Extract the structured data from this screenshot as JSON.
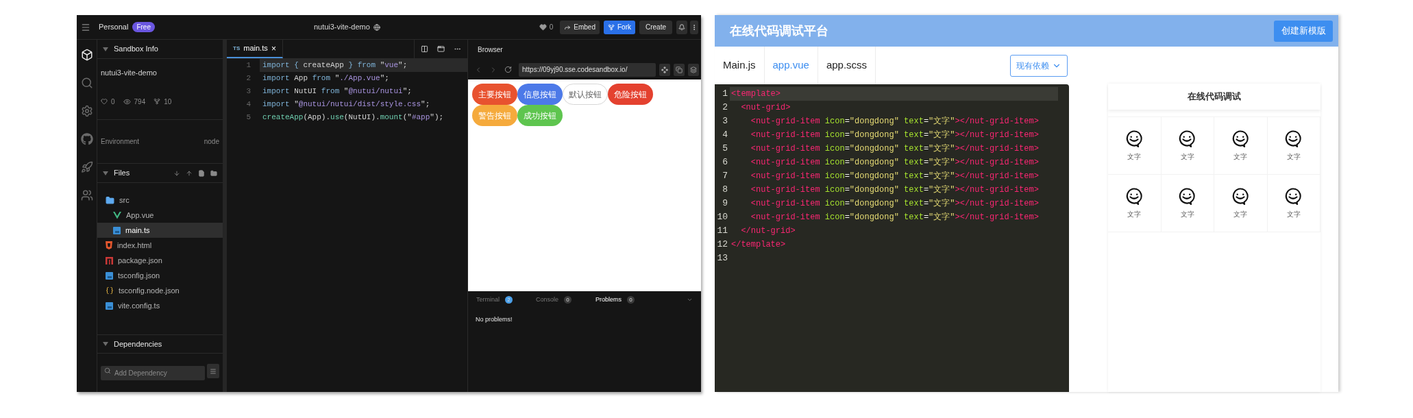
{
  "left": {
    "topbar": {
      "workspace": "Personal",
      "plan": "Free",
      "title": "nutui3-vite-demo",
      "likes": "0",
      "embed": "Embed",
      "fork": "Fork",
      "create": "Create"
    },
    "activity_bar": [
      {
        "kind": "cube",
        "selected": true
      },
      {
        "kind": "search",
        "selected": false
      },
      {
        "kind": "gear",
        "selected": false
      },
      {
        "kind": "github",
        "selected": false
      },
      {
        "kind": "rocket",
        "selected": false
      },
      {
        "kind": "users",
        "selected": false
      }
    ],
    "sandbox_info": {
      "title": "Sandbox Info",
      "name": "nutui3-vite-demo",
      "likes": "0",
      "views": "794",
      "forks": "10",
      "environment_label": "Environment",
      "environment": "node"
    },
    "files": {
      "title": "Files",
      "tree": [
        {
          "name": "src",
          "kind": "folder",
          "selected": false,
          "children": [
            {
              "name": "App.vue",
              "kind": "vue",
              "selected": false
            },
            {
              "name": "main.ts",
              "kind": "ts",
              "selected": true
            }
          ]
        },
        {
          "name": "index.html",
          "kind": "html",
          "selected": false
        },
        {
          "name": "package.json",
          "kind": "npm",
          "selected": false
        },
        {
          "name": "tsconfig.json",
          "kind": "ts",
          "selected": false
        },
        {
          "name": "tsconfig.node.json",
          "kind": "json",
          "selected": false
        },
        {
          "name": "vite.config.ts",
          "kind": "ts",
          "selected": false
        }
      ]
    },
    "dependencies": {
      "title": "Dependencies",
      "search": {
        "placeholder": "Add Dependency"
      }
    },
    "editor": {
      "tab": {
        "badge": "TS",
        "label": "main.ts",
        "close": "×"
      },
      "lines": [
        {
          "number": "1",
          "active": true,
          "tokens": [
            {
              "text": "import",
              "kind": "kw"
            },
            {
              "text": " { ",
              "kind": "kw"
            },
            {
              "text": "createApp",
              "kind": "plain"
            },
            {
              "text": " } ",
              "kind": "kw"
            },
            {
              "text": "from",
              "kind": "kw"
            },
            {
              "text": " \"",
              "kind": "plain"
            },
            {
              "text": "vue",
              "kind": "str"
            },
            {
              "text": "\";",
              "kind": "plain"
            }
          ]
        },
        {
          "number": "2",
          "active": false,
          "tokens": [
            {
              "text": "import",
              "kind": "kw"
            },
            {
              "text": " App ",
              "kind": "plain"
            },
            {
              "text": "from",
              "kind": "kw"
            },
            {
              "text": " \"",
              "kind": "plain"
            },
            {
              "text": "./App.vue",
              "kind": "str"
            },
            {
              "text": "\";",
              "kind": "plain"
            }
          ]
        },
        {
          "number": "3",
          "active": false,
          "tokens": [
            {
              "text": "import",
              "kind": "kw"
            },
            {
              "text": " NutUI ",
              "kind": "plain"
            },
            {
              "text": "from",
              "kind": "kw"
            },
            {
              "text": " \"",
              "kind": "plain"
            },
            {
              "text": "@nutui/nutui",
              "kind": "str"
            },
            {
              "text": "\";",
              "kind": "plain"
            }
          ]
        },
        {
          "number": "4",
          "active": false,
          "tokens": [
            {
              "text": "import",
              "kind": "kw"
            },
            {
              "text": " \"",
              "kind": "plain"
            },
            {
              "text": "@nutui/nutui/dist/style.css",
              "kind": "str"
            },
            {
              "text": "\";",
              "kind": "plain"
            }
          ]
        },
        {
          "number": "5",
          "active": false,
          "tokens": [
            {
              "text": "createApp",
              "kind": "fn"
            },
            {
              "text": "(App).",
              "kind": "plain"
            },
            {
              "text": "use",
              "kind": "fn"
            },
            {
              "text": "(NutUI).",
              "kind": "plain"
            },
            {
              "text": "mount",
              "kind": "fn"
            },
            {
              "text": "(\"",
              "kind": "plain"
            },
            {
              "text": "#app",
              "kind": "str"
            },
            {
              "text": "\");",
              "kind": "plain"
            }
          ]
        }
      ]
    },
    "browser": {
      "title": "Browser",
      "url": "https://09yj90.sse.codesandbox.io/",
      "buttons": [
        {
          "label": "主要按钮",
          "kind": "filled",
          "color": "#e8522f"
        },
        {
          "label": "信息按钮",
          "kind": "filled",
          "color": "#4c79e8"
        },
        {
          "label": "默认按钮",
          "kind": "outline",
          "color": "#ffffff"
        },
        {
          "label": "危险按钮",
          "kind": "filled",
          "color": "#e4412f"
        },
        {
          "label": "警告按钮",
          "kind": "filled",
          "color": "#f5aa3c"
        },
        {
          "label": "成功按钮",
          "kind": "filled",
          "color": "#5ec54f"
        }
      ]
    },
    "panel": {
      "tabs": [
        {
          "label": "Terminal",
          "count": "2",
          "color": "#4a9fe8",
          "selected": false
        },
        {
          "label": "Console",
          "count": "0",
          "color": "#3c3c3c",
          "selected": false
        },
        {
          "label": "Problems",
          "count": "0",
          "color": "#3c3c3c",
          "selected": true
        }
      ],
      "message": "No problems!"
    }
  },
  "right": {
    "header": {
      "title": "在线代码调试平台",
      "button": "创建新模版"
    },
    "tabs": [
      {
        "label": "Main.js",
        "selected": false
      },
      {
        "label": "app.vue",
        "selected": true
      },
      {
        "label": "app.scss",
        "selected": false
      }
    ],
    "deps_button": "现有依赖",
    "editor": {
      "lines": [
        {
          "number": "1",
          "active": true,
          "tokens": [
            {
              "text": "<template>",
              "kind": "tag"
            }
          ]
        },
        {
          "number": "2",
          "active": false,
          "tokens": [
            {
              "text": "  <nut-grid>",
              "kind": "tag"
            }
          ]
        },
        {
          "number": "3",
          "active": false,
          "tokens": [
            {
              "text": "    <nut-grid-item",
              "kind": "tag"
            },
            {
              "text": " icon",
              "kind": "attr"
            },
            {
              "text": "=",
              "kind": "punct"
            },
            {
              "text": "\"dongdong\"",
              "kind": "val"
            },
            {
              "text": " text",
              "kind": "attr"
            },
            {
              "text": "=",
              "kind": "punct"
            },
            {
              "text": "\"文字\"",
              "kind": "val"
            },
            {
              "text": "></nut-grid-item>",
              "kind": "tag"
            }
          ]
        },
        {
          "number": "4",
          "active": false,
          "tokens": [
            {
              "text": "    <nut-grid-item",
              "kind": "tag"
            },
            {
              "text": " icon",
              "kind": "attr"
            },
            {
              "text": "=",
              "kind": "punct"
            },
            {
              "text": "\"dongdong\"",
              "kind": "val"
            },
            {
              "text": " text",
              "kind": "attr"
            },
            {
              "text": "=",
              "kind": "punct"
            },
            {
              "text": "\"文字\"",
              "kind": "val"
            },
            {
              "text": "></nut-grid-item>",
              "kind": "tag"
            }
          ]
        },
        {
          "number": "5",
          "active": false,
          "tokens": [
            {
              "text": "    <nut-grid-item",
              "kind": "tag"
            },
            {
              "text": " icon",
              "kind": "attr"
            },
            {
              "text": "=",
              "kind": "punct"
            },
            {
              "text": "\"dongdong\"",
              "kind": "val"
            },
            {
              "text": " text",
              "kind": "attr"
            },
            {
              "text": "=",
              "kind": "punct"
            },
            {
              "text": "\"文字\"",
              "kind": "val"
            },
            {
              "text": "></nut-grid-item>",
              "kind": "tag"
            }
          ]
        },
        {
          "number": "6",
          "active": false,
          "tokens": [
            {
              "text": "    <nut-grid-item",
              "kind": "tag"
            },
            {
              "text": " icon",
              "kind": "attr"
            },
            {
              "text": "=",
              "kind": "punct"
            },
            {
              "text": "\"dongdong\"",
              "kind": "val"
            },
            {
              "text": " text",
              "kind": "attr"
            },
            {
              "text": "=",
              "kind": "punct"
            },
            {
              "text": "\"文字\"",
              "kind": "val"
            },
            {
              "text": "></nut-grid-item>",
              "kind": "tag"
            }
          ]
        },
        {
          "number": "7",
          "active": false,
          "tokens": [
            {
              "text": "    <nut-grid-item",
              "kind": "tag"
            },
            {
              "text": " icon",
              "kind": "attr"
            },
            {
              "text": "=",
              "kind": "punct"
            },
            {
              "text": "\"dongdong\"",
              "kind": "val"
            },
            {
              "text": " text",
              "kind": "attr"
            },
            {
              "text": "=",
              "kind": "punct"
            },
            {
              "text": "\"文字\"",
              "kind": "val"
            },
            {
              "text": "></nut-grid-item>",
              "kind": "tag"
            }
          ]
        },
        {
          "number": "8",
          "active": false,
          "tokens": [
            {
              "text": "    <nut-grid-item",
              "kind": "tag"
            },
            {
              "text": " icon",
              "kind": "attr"
            },
            {
              "text": "=",
              "kind": "punct"
            },
            {
              "text": "\"dongdong\"",
              "kind": "val"
            },
            {
              "text": " text",
              "kind": "attr"
            },
            {
              "text": "=",
              "kind": "punct"
            },
            {
              "text": "\"文字\"",
              "kind": "val"
            },
            {
              "text": "></nut-grid-item>",
              "kind": "tag"
            }
          ]
        },
        {
          "number": "9",
          "active": false,
          "tokens": [
            {
              "text": "    <nut-grid-item",
              "kind": "tag"
            },
            {
              "text": " icon",
              "kind": "attr"
            },
            {
              "text": "=",
              "kind": "punct"
            },
            {
              "text": "\"dongdong\"",
              "kind": "val"
            },
            {
              "text": " text",
              "kind": "attr"
            },
            {
              "text": "=",
              "kind": "punct"
            },
            {
              "text": "\"文字\"",
              "kind": "val"
            },
            {
              "text": "></nut-grid-item>",
              "kind": "tag"
            }
          ]
        },
        {
          "number": "10",
          "active": false,
          "tokens": [
            {
              "text": "    <nut-grid-item",
              "kind": "tag"
            },
            {
              "text": " icon",
              "kind": "attr"
            },
            {
              "text": "=",
              "kind": "punct"
            },
            {
              "text": "\"dongdong\"",
              "kind": "val"
            },
            {
              "text": " text",
              "kind": "attr"
            },
            {
              "text": "=",
              "kind": "punct"
            },
            {
              "text": "\"文字\"",
              "kind": "val"
            },
            {
              "text": "></nut-grid-item>",
              "kind": "tag"
            }
          ]
        },
        {
          "number": "11",
          "active": false,
          "tokens": [
            {
              "text": "  </nut-grid>",
              "kind": "tag"
            }
          ]
        },
        {
          "number": "12",
          "active": false,
          "tokens": [
            {
              "text": "</template>",
              "kind": "tag"
            }
          ]
        },
        {
          "number": "13",
          "active": false
        }
      ]
    },
    "preview": {
      "title": "在线代码调试",
      "items": [
        {
          "text": "文字"
        },
        {
          "text": "文字"
        },
        {
          "text": "文字"
        },
        {
          "text": "文字"
        },
        {
          "text": "文字"
        },
        {
          "text": "文字"
        },
        {
          "text": "文字"
        },
        {
          "text": "文字"
        }
      ]
    }
  }
}
